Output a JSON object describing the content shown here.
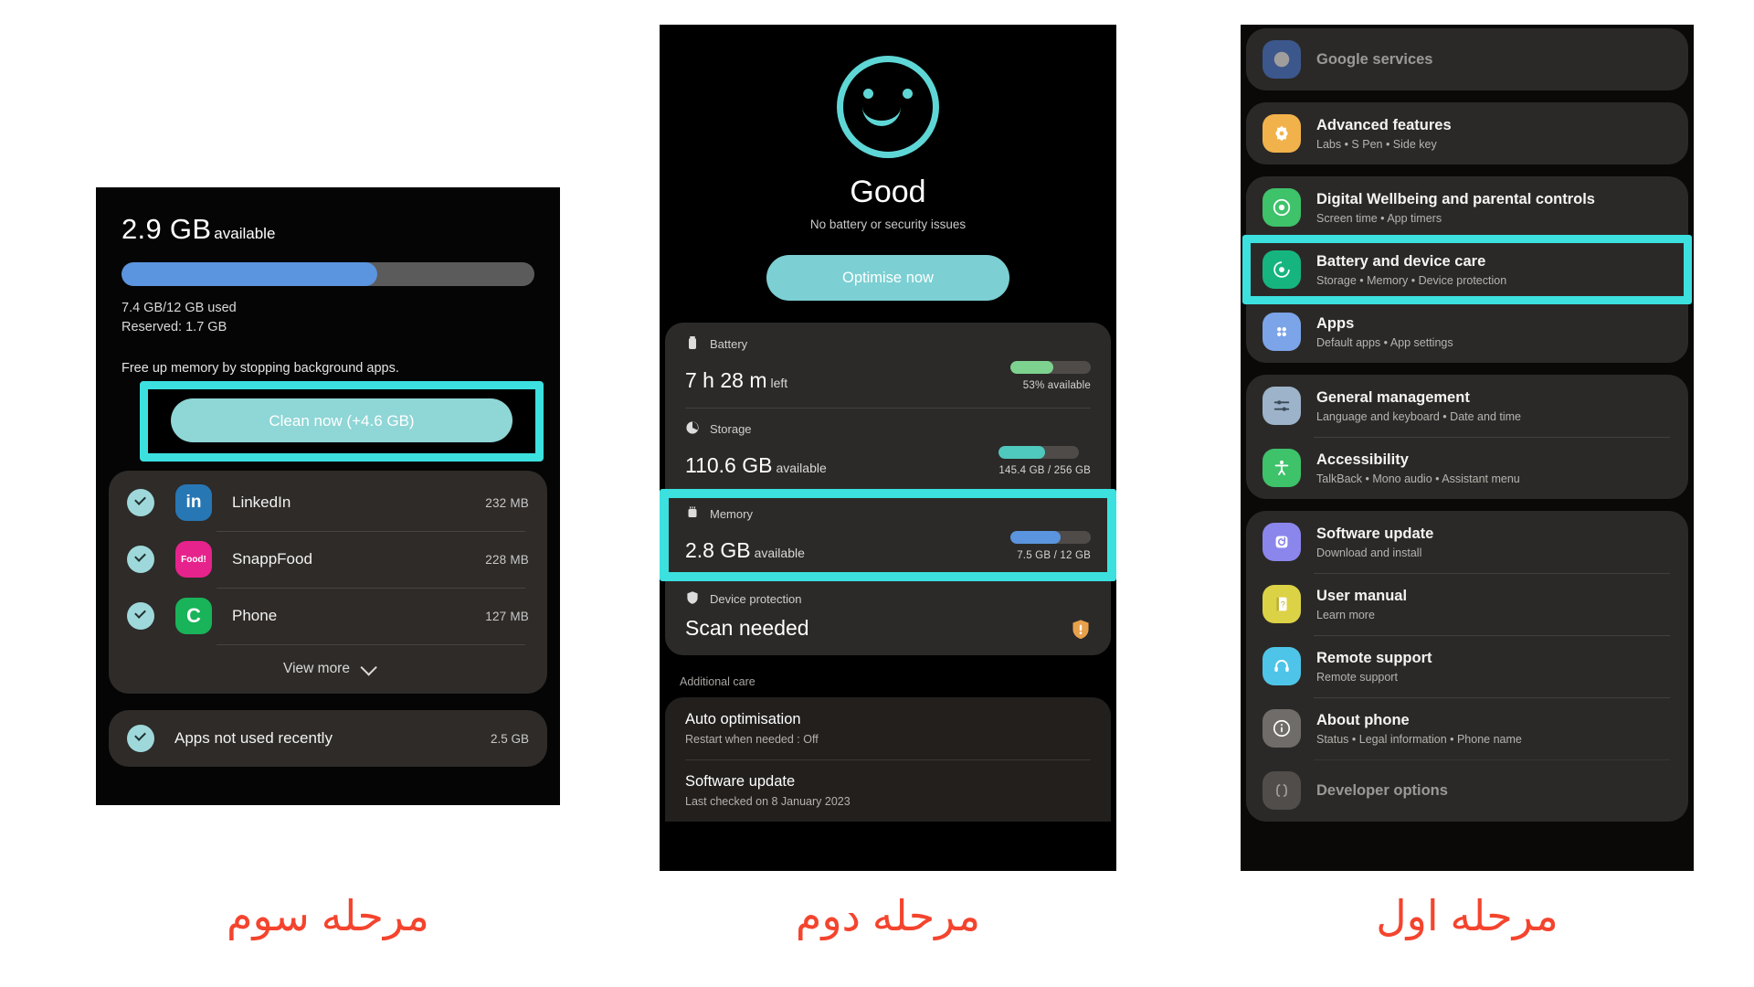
{
  "steps": {
    "left_caption": "مرحله سوم",
    "middle_caption": "مرحله دوم",
    "right_caption": "مرحله اول"
  },
  "colors": {
    "highlight": "#3ce0df",
    "accent_teal": "#7ccfd2",
    "memory_bar": "#5b94df",
    "battery_bar": "#7ed28f",
    "storage_bar": "#4fc8bd",
    "caption_red": "#f4442e"
  },
  "memory_screen": {
    "available_value": "2.9 GB",
    "available_label": "available",
    "used_line": "7.4 GB/12 GB used",
    "reserved_line": "Reserved: 1.7 GB",
    "hint": "Free up memory by stopping background apps.",
    "clean_button": "Clean now (+4.6 GB)",
    "bar_percent": 62,
    "apps": [
      {
        "name": "LinkedIn",
        "size": "232 MB",
        "icon": "linkedin-icon",
        "glyph": "in",
        "checked": true
      },
      {
        "name": "SnappFood",
        "size": "228 MB",
        "icon": "snappfood-icon",
        "glyph": "Food!",
        "checked": true
      },
      {
        "name": "Phone",
        "size": "127 MB",
        "icon": "phone-icon",
        "glyph": "C",
        "checked": true
      }
    ],
    "view_more": "View more",
    "unused": {
      "label": "Apps not used recently",
      "size": "2.5 GB",
      "checked": true
    }
  },
  "device_care_screen": {
    "status_title": "Good",
    "status_subtitle": "No battery or security issues",
    "optimise_button": "Optimise now",
    "face_icon": "smiley-face-icon",
    "cards": [
      {
        "label": "Battery",
        "icon": "battery-icon",
        "value": "7 h 28 m",
        "unit": "left",
        "meter_percent": 53,
        "meter_caption": "53% available",
        "meter_color": "#7ed28f",
        "highlighted": false
      },
      {
        "label": "Storage",
        "icon": "storage-pie-icon",
        "value": "110.6 GB",
        "unit": "available",
        "meter_percent": 57,
        "meter_caption": "145.4 GB / 256 GB",
        "meter_color": "#4fc8bd",
        "highlighted": false
      },
      {
        "label": "Memory",
        "icon": "memory-chip-icon",
        "value": "2.8 GB",
        "unit": "available",
        "meter_percent": 62,
        "meter_caption": "7.5 GB / 12 GB",
        "meter_color": "#5b94df",
        "highlighted": true
      },
      {
        "label": "Device protection",
        "icon": "shield-icon",
        "value": "Scan needed",
        "unit": "",
        "meter_percent": 0,
        "meter_caption": "",
        "meter_color": "",
        "highlighted": false,
        "warning_icon": "shield-warning-icon"
      }
    ],
    "additional_care_label": "Additional care",
    "additional_items": [
      {
        "title": "Auto optimisation",
        "subtitle": "Restart when needed : Off"
      },
      {
        "title": "Software update",
        "subtitle": "Last checked on 8 January 2023"
      }
    ]
  },
  "settings_screen": {
    "items": [
      {
        "title": "Google services",
        "subtitle": "",
        "icon": "google-icon",
        "icon_color": "#4a7ee0",
        "group_start": true,
        "group_end": true,
        "partial": true,
        "highlighted": false
      },
      {
        "title": "Advanced features",
        "subtitle": "Labs • S Pen • Side key",
        "icon": "advanced-features-icon",
        "icon_color": "#f2b24b",
        "group_start": true,
        "group_end": true,
        "partial": false,
        "highlighted": false
      },
      {
        "title": "Digital Wellbeing and parental controls",
        "subtitle": "Screen time • App timers",
        "icon": "digital-wellbeing-icon",
        "icon_color": "#3ec26a",
        "group_start": true,
        "group_end": false,
        "partial": false,
        "highlighted": false
      },
      {
        "title": "Battery and device care",
        "subtitle": "Storage • Memory • Device protection",
        "icon": "battery-device-care-icon",
        "icon_color": "#16b57f",
        "group_start": false,
        "group_end": false,
        "partial": false,
        "highlighted": true
      },
      {
        "title": "Apps",
        "subtitle": "Default apps • App settings",
        "icon": "apps-grid-icon",
        "icon_color": "#7ca4e8",
        "group_start": false,
        "group_end": true,
        "partial": false,
        "highlighted": false
      },
      {
        "title": "General management",
        "subtitle": "Language and keyboard • Date and time",
        "icon": "sliders-icon",
        "icon_color": "#9cb3c9",
        "group_start": true,
        "group_end": false,
        "partial": false,
        "highlighted": false
      },
      {
        "title": "Accessibility",
        "subtitle": "TalkBack • Mono audio • Assistant menu",
        "icon": "accessibility-icon",
        "icon_color": "#3ec26a",
        "group_start": false,
        "group_end": true,
        "partial": false,
        "highlighted": false
      },
      {
        "title": "Software update",
        "subtitle": "Download and install",
        "icon": "software-update-icon",
        "icon_color": "#8b86ec",
        "group_start": true,
        "group_end": false,
        "partial": false,
        "highlighted": false
      },
      {
        "title": "User manual",
        "subtitle": "Learn more",
        "icon": "user-manual-icon",
        "icon_color": "#dcd246",
        "group_start": false,
        "group_end": false,
        "partial": false,
        "highlighted": false
      },
      {
        "title": "Remote support",
        "subtitle": "Remote support",
        "icon": "headset-icon",
        "icon_color": "#4ec5e8",
        "group_start": false,
        "group_end": false,
        "partial": false,
        "highlighted": false
      },
      {
        "title": "About phone",
        "subtitle": "Status • Legal information • Phone name",
        "icon": "info-icon",
        "icon_color": "#6f6c69",
        "group_start": false,
        "group_end": false,
        "partial": false,
        "highlighted": false
      },
      {
        "title": "Developer options",
        "subtitle": "",
        "icon": "developer-options-icon",
        "icon_color": "#6f6c69",
        "group_start": false,
        "group_end": true,
        "partial": true,
        "highlighted": false
      }
    ]
  }
}
